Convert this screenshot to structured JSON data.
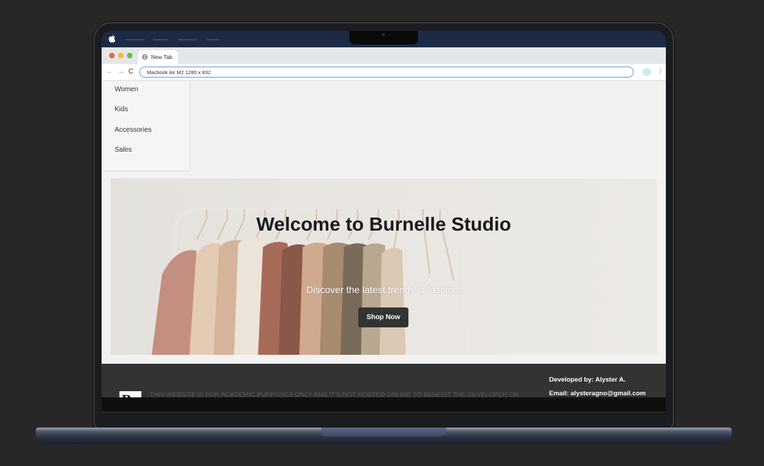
{
  "browser": {
    "tab_title": "New Tab",
    "address": "Macbook Air M2   1280 x 832"
  },
  "side_menu": {
    "items": [
      "Women",
      "Kids",
      "Accessories",
      "Sales"
    ]
  },
  "hero": {
    "title": "Welcome to Burnelle Studio",
    "subtitle": "Discover the latest trends in fashion.",
    "cta_label": "Shop Now"
  },
  "footer": {
    "logo_letter": "B",
    "notice": "THIS WEBSITE IS FOR ACADEMIC PURPOSES ONLY AND IT'S NOT HOSTED ONLINE TO BENEFIT THE DEVELOPER OR",
    "developer": "Developed by: Alyster A.",
    "email": "Email: alysteragno@gmail.com"
  },
  "colors": {
    "menubar": "#1c2a45",
    "footer": "#333333",
    "cta": "#333333",
    "address_border": "#5b9bd5"
  },
  "icons": [
    "apple-icon",
    "globe-icon",
    "back-icon",
    "forward-icon",
    "reload-icon",
    "profile-icon",
    "more-menu-icon"
  ]
}
